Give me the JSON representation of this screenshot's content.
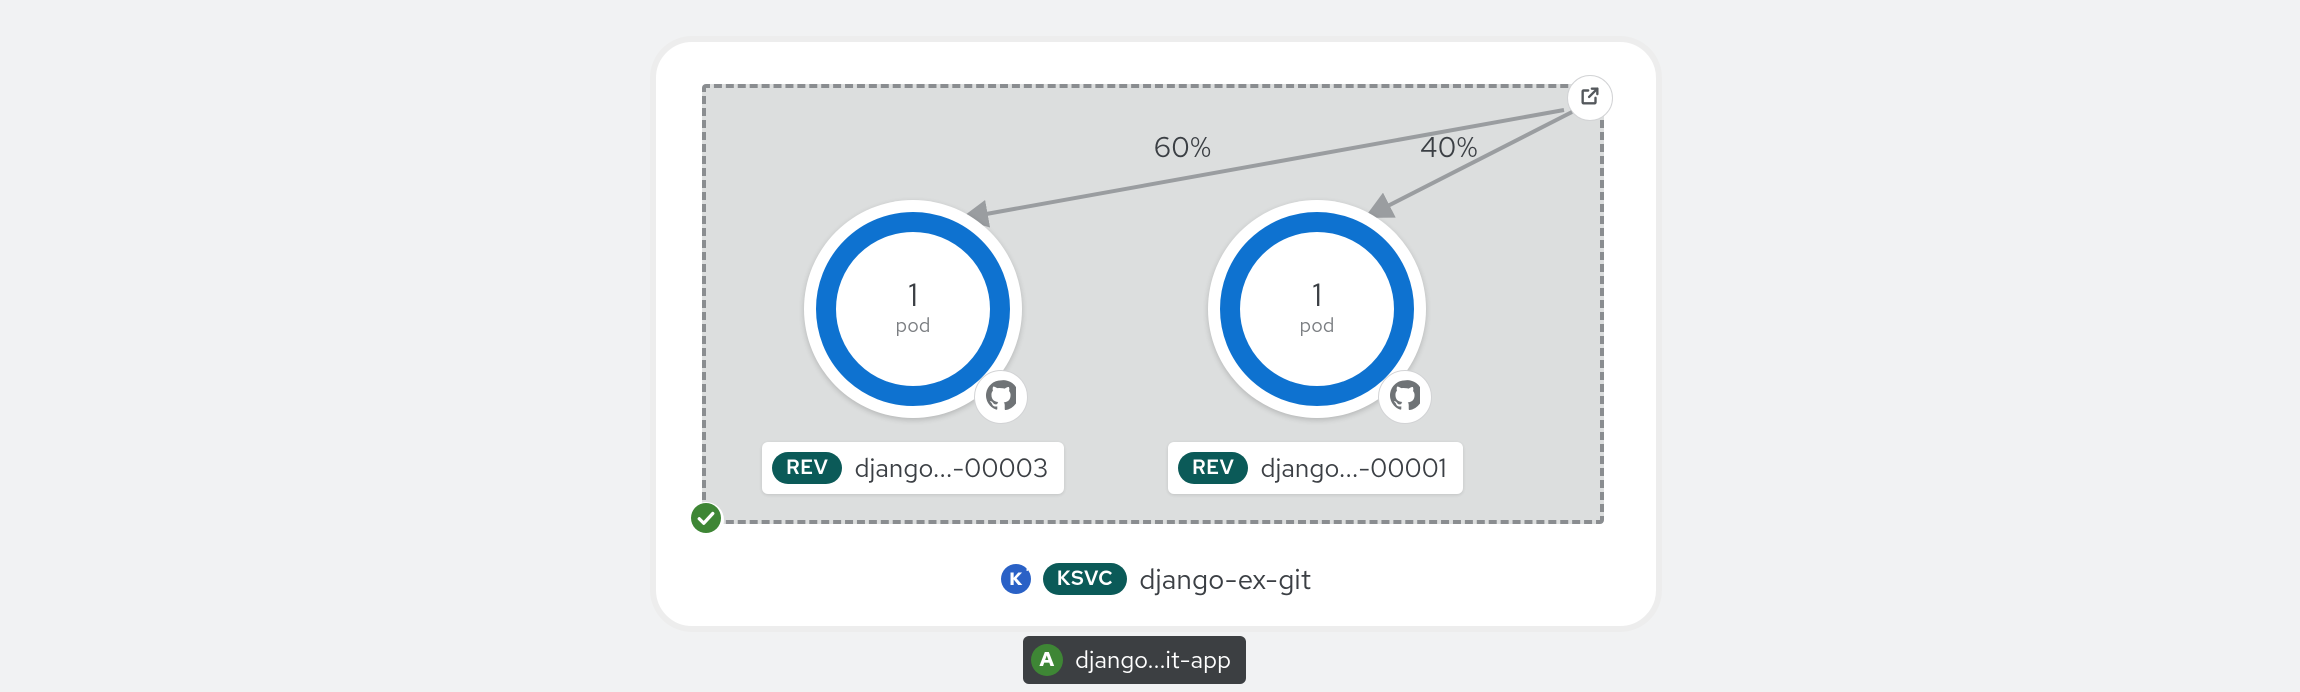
{
  "service": {
    "badge": "KSVC",
    "name": "django-ex-git"
  },
  "inner": {
    "open_icon": "open-external-icon",
    "success_icon": "success-check-icon",
    "revisions": [
      {
        "traffic_percent": "60%",
        "pod_count": "1",
        "pod_unit": "pod",
        "decorator_icon": "github-icon",
        "badge": "REV",
        "label": "django...-00003"
      },
      {
        "traffic_percent": "40%",
        "pod_count": "1",
        "pod_unit": "pod",
        "decorator_icon": "github-icon",
        "badge": "REV",
        "label": "django...-00001"
      }
    ]
  },
  "app": {
    "badge": "A",
    "label": "django...it-app"
  },
  "colors": {
    "ring": "#0e72d0",
    "teal_badge": "#0b5a58",
    "success": "#3e8635",
    "knative": "#2a61c6",
    "app_pill": "#3c3f42"
  }
}
